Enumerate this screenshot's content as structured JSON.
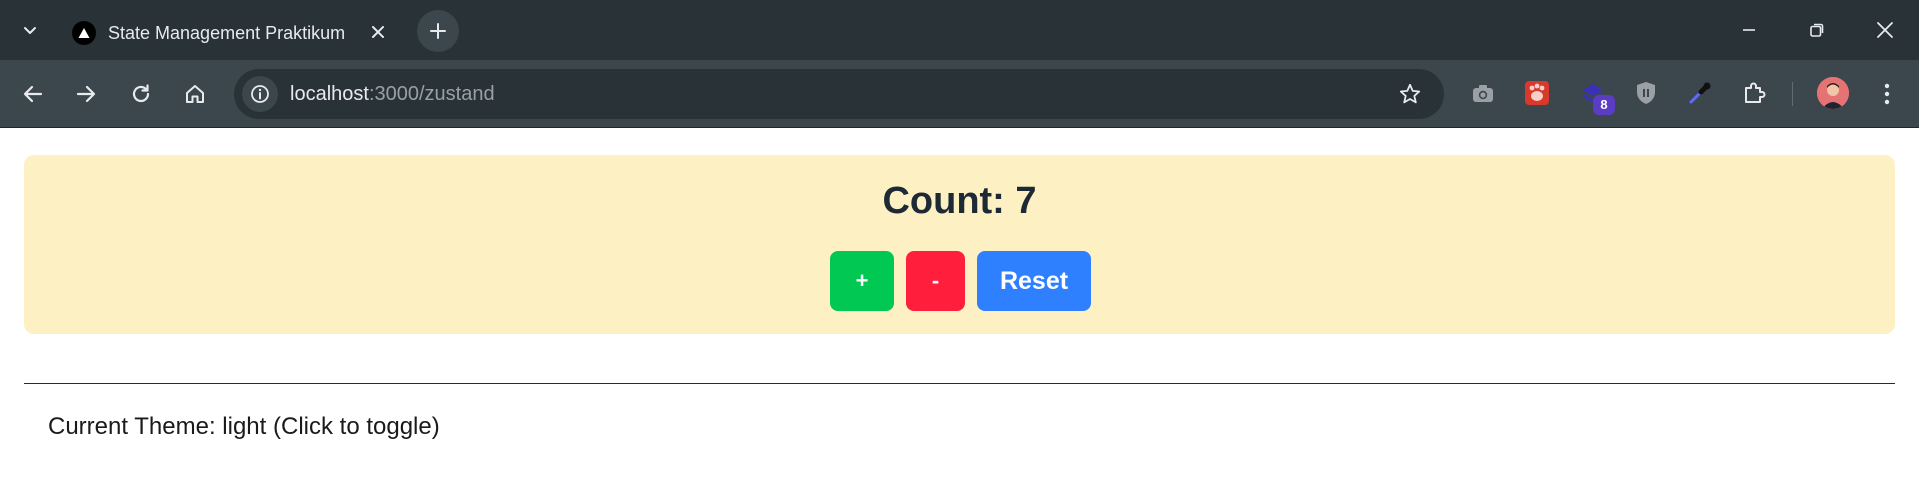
{
  "browser": {
    "tab": {
      "title": "State Management Praktikum"
    },
    "address_bar": {
      "host": "localhost",
      "path": ":3000/zustand"
    },
    "extensions": [
      {
        "name": "camera-extension-icon"
      },
      {
        "name": "paw-extension-icon"
      },
      {
        "name": "puzzle-stack-extension-icon",
        "badge": "8"
      },
      {
        "name": "shield-extension-icon"
      },
      {
        "name": "color-picker-extension-icon"
      },
      {
        "name": "extensions-puzzle-icon"
      }
    ],
    "colors": {
      "frame": "#283237",
      "toolbar": "#3c474d"
    }
  },
  "page": {
    "counter": {
      "label": "Count:",
      "value": "7",
      "increment_label": "+",
      "decrement_label": "-",
      "reset_label": "Reset"
    },
    "theme": {
      "text": "Current Theme: light (Click to toggle)"
    },
    "colors": {
      "card_bg": "#fdf1c4",
      "increment": "#00c853",
      "decrement": "#ff1f3d",
      "reset": "#2f80ff"
    }
  }
}
